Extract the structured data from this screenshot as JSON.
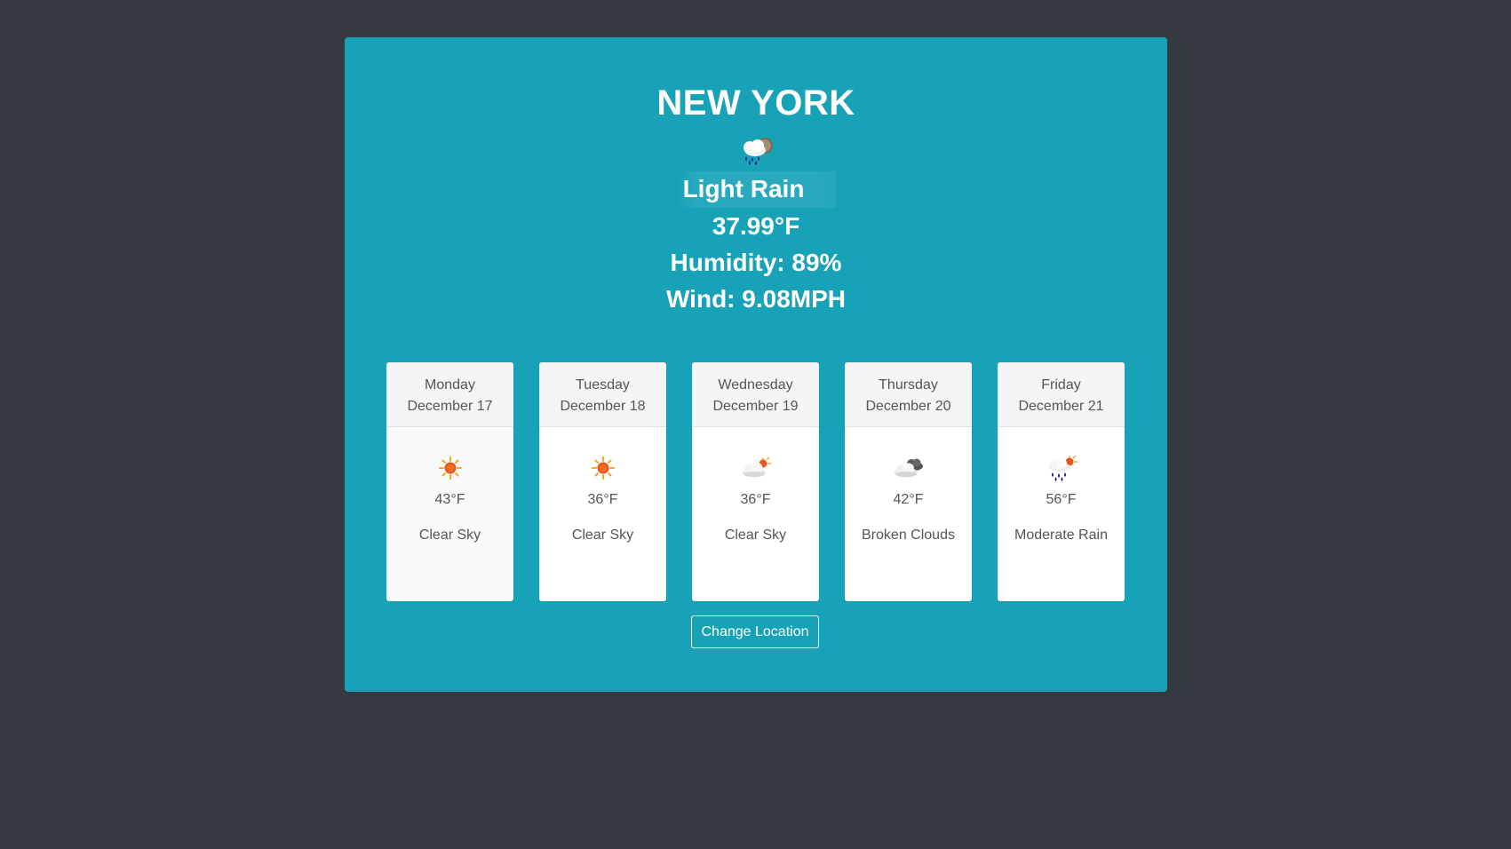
{
  "current": {
    "city": "NEW YORK",
    "icon": "rain-cloud-night-icon",
    "description": "Light Rain",
    "temperature": "37.99°F",
    "humidity": "Humidity: 89%",
    "wind": "Wind: 9.08MPH"
  },
  "forecast": [
    {
      "day": "Monday",
      "date": "December 17",
      "icon": "sun-icon",
      "temp": "43°F",
      "desc": "Clear Sky"
    },
    {
      "day": "Tuesday",
      "date": "December 18",
      "icon": "sun-icon",
      "temp": "36°F",
      "desc": "Clear Sky"
    },
    {
      "day": "Wednesday",
      "date": "December 19",
      "icon": "cloud-sun-icon",
      "temp": "36°F",
      "desc": "Clear Sky"
    },
    {
      "day": "Thursday",
      "date": "December 20",
      "icon": "broken-clouds-icon",
      "temp": "42°F",
      "desc": "Broken Clouds"
    },
    {
      "day": "Friday",
      "date": "December 21",
      "icon": "rain-cloud-sun-icon",
      "temp": "56°F",
      "desc": "Moderate Rain"
    }
  ],
  "actions": {
    "change_location": "Change Location"
  },
  "colors": {
    "background": "#343a40",
    "panel": "#17a2b8",
    "card": "#ffffff",
    "card_header": "#f4f5f6"
  }
}
